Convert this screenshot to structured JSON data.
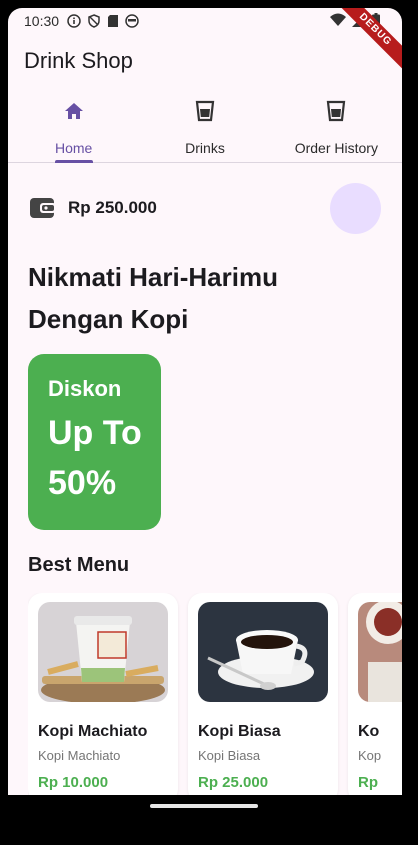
{
  "status_bar": {
    "time": "10:30",
    "debug_label": "DEBUG"
  },
  "app": {
    "title": "Drink Shop"
  },
  "tabs": [
    {
      "label": "Home",
      "icon": "home-icon",
      "active": true
    },
    {
      "label": "Drinks",
      "icon": "cup-icon",
      "active": false
    },
    {
      "label": "Order History",
      "icon": "cup-icon",
      "active": false
    }
  ],
  "wallet": {
    "amount": "Rp 250.000",
    "icon": "wallet-icon"
  },
  "headline": {
    "line1": "Nikmati Hari-Harimu",
    "line2": "Dengan Kopi"
  },
  "promo": {
    "line1": "Diskon",
    "line2": "Up To",
    "line3": "50%"
  },
  "best_menu": {
    "title": "Best Menu",
    "items": [
      {
        "name": "Kopi Machiato",
        "subtitle": "Kopi Machiato",
        "price": "Rp 10.000"
      },
      {
        "name": "Kopi Biasa",
        "subtitle": "Kopi Biasa",
        "price": "Rp 25.000"
      },
      {
        "name": "Ko",
        "subtitle": "Kop",
        "price": "Rp"
      }
    ]
  },
  "colors": {
    "accent": "#6750a4",
    "promo": "#4caf50",
    "price": "#4caf50",
    "avatar": "#e9ddff",
    "background": "#fef7fb"
  }
}
